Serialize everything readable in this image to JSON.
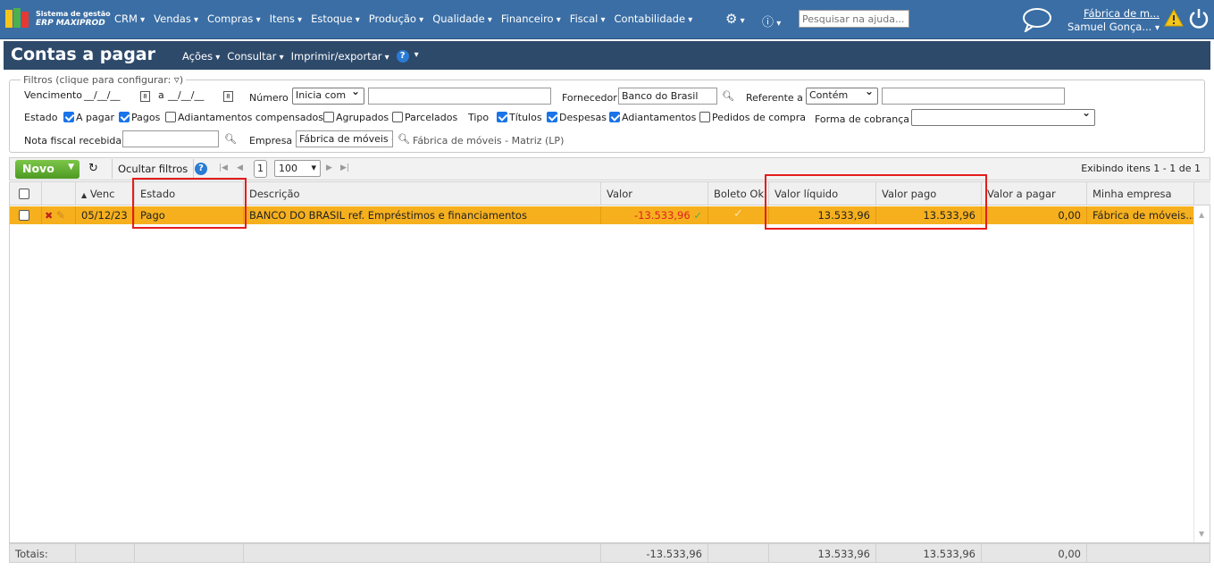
{
  "app": {
    "logo_line1": "Sistema de gestão",
    "logo_line2": "ERP MAXIPROD",
    "menu": [
      "CRM",
      "Vendas",
      "Compras",
      "Itens",
      "Estoque",
      "Produção",
      "Qualidade",
      "Financeiro",
      "Fiscal",
      "Contabilidade"
    ],
    "help_search_placeholder": "Pesquisar na ajuda...",
    "company": "Fábrica de m...",
    "user": "Samuel Gonça..."
  },
  "page": {
    "title": "Contas a pagar",
    "menu": [
      "Ações",
      "Consultar",
      "Imprimir/exportar"
    ]
  },
  "filters": {
    "legend": "Filtros (clique para configurar:",
    "vencimento_label": "Vencimento",
    "date_from": "__/__/__",
    "date_sep": "a",
    "date_to": "__/__/__",
    "numero_label": "Número",
    "numero_mode": "Inicia com",
    "fornecedor_label": "Fornecedor",
    "fornecedor_value": "Banco do Brasil",
    "referente_label": "Referente a",
    "referente_mode": "Contém",
    "estado_label": "Estado",
    "estado_options": [
      {
        "label": "A pagar",
        "checked": true
      },
      {
        "label": "Pagos",
        "checked": true
      },
      {
        "label": "Adiantamentos compensados",
        "checked": false
      },
      {
        "label": "Agrupados",
        "checked": false
      },
      {
        "label": "Parcelados",
        "checked": false
      }
    ],
    "tipo_label": "Tipo",
    "tipo_options": [
      {
        "label": "Títulos",
        "checked": true
      },
      {
        "label": "Despesas",
        "checked": true
      },
      {
        "label": "Adiantamentos",
        "checked": true
      },
      {
        "label": "Pedidos de compra",
        "checked": false
      }
    ],
    "forma_cobranca_label": "Forma de cobrança",
    "nf_label": "Nota fiscal recebida",
    "empresa_label": "Empresa",
    "empresa_value": "Fábrica de móveis -",
    "empresa_desc": "Fábrica de móveis - Matriz (LP)"
  },
  "toolbar": {
    "novo": "Novo",
    "ocultar": "Ocultar filtros",
    "page": "1",
    "page_size": "100",
    "showing": "Exibindo itens 1 - 1 de 1"
  },
  "columns": {
    "venc": "Venc",
    "estado": "Estado",
    "descricao": "Descrição",
    "valor": "Valor",
    "boleto_ok": "Boleto Ok",
    "valor_liquido": "Valor líquido",
    "valor_pago": "Valor pago",
    "valor_a_pagar": "Valor a pagar",
    "minha_empresa": "Minha empresa"
  },
  "rows": [
    {
      "venc": "05/12/23",
      "estado": "Pago",
      "descricao": "BANCO DO BRASIL ref. Empréstimos e financiamentos",
      "valor": "-13.533,96",
      "valor_liquido": "13.533,96",
      "valor_pago": "13.533,96",
      "valor_a_pagar": "0,00",
      "minha_empresa": "Fábrica de móveis..."
    }
  ],
  "totals": {
    "label": "Totais:",
    "valor": "-13.533,96",
    "valor_liquido": "13.533,96",
    "valor_pago": "13.533,96",
    "valor_a_pagar": "0,00"
  },
  "colors": {
    "row_highlight": "#f6b01e",
    "negative": "#e02020",
    "topbar": "#3a6ea5",
    "pagebar": "#2e4a6b",
    "highlight_box": "#e51c1c"
  }
}
